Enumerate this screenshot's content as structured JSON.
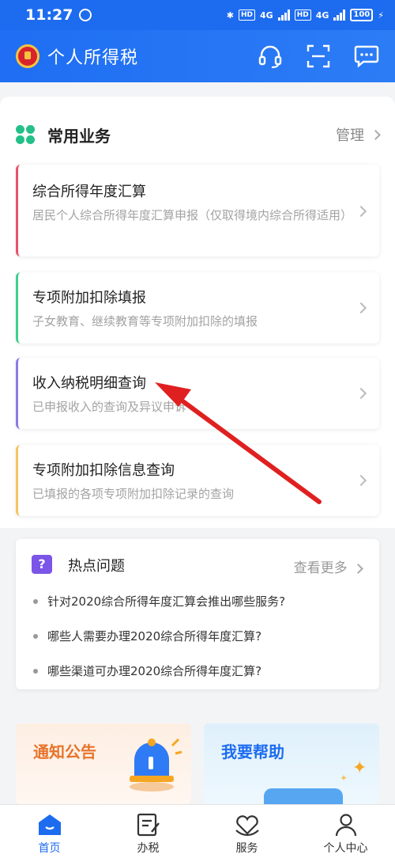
{
  "status_bar": {
    "time": "11:27",
    "network1": "4G",
    "network2": "4G",
    "hd": "HD",
    "battery": "100"
  },
  "app_bar": {
    "title": "个人所得税",
    "icons": [
      "headset-icon",
      "scan-icon",
      "message-icon"
    ]
  },
  "common_services": {
    "title": "常用业务",
    "manage_label": "管理",
    "cards": [
      {
        "title": "综合所得年度汇算",
        "desc": "居民个人综合所得年度汇算申报（仅取得境内综合所得适用）",
        "accent": "#e8516b"
      },
      {
        "title": "专项附加扣除填报",
        "desc": "子女教育、继续教育等专项附加扣除的填报",
        "accent": "#3ecf8e"
      },
      {
        "title": "收入纳税明细查询",
        "desc": "已申报收入的查询及异议申诉",
        "accent": "#8a7be6"
      },
      {
        "title": "专项附加扣除信息查询",
        "desc": "已填报的各项专项附加扣除记录的查询",
        "accent": "#f5c563"
      }
    ]
  },
  "hot_questions": {
    "icon_text": "?",
    "title": "热点问题",
    "more_label": "查看更多",
    "items": [
      "针对2020综合所得年度汇算会推出哪些服务?",
      "哪些人需要办理2020综合所得年度汇算?",
      "哪些渠道可办理2020综合所得年度汇算?"
    ]
  },
  "promos": [
    {
      "label": "通知公告",
      "color": "#e8732a"
    },
    {
      "label": "我要帮助",
      "color": "#1d6cf0"
    }
  ],
  "tab_bar": {
    "tabs": [
      "首页",
      "办税",
      "服务",
      "个人中心"
    ],
    "active": "首页"
  },
  "colors": {
    "primary": "#1d6cf0",
    "annotation_arrow": "#e02020"
  }
}
